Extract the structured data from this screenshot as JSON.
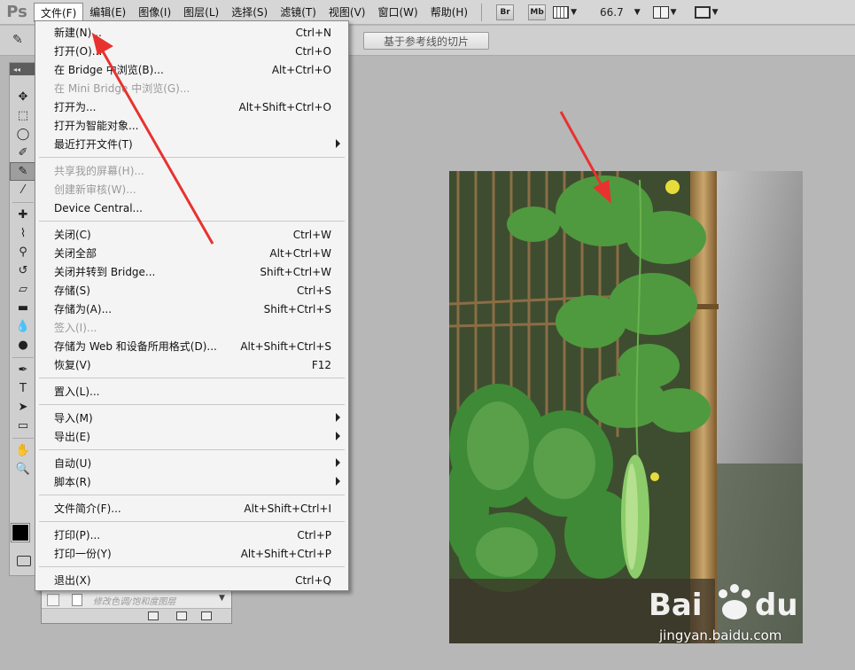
{
  "app": {
    "logo": "Ps"
  },
  "menubar": {
    "items": [
      "文件(F)",
      "编辑(E)",
      "图像(I)",
      "图层(L)",
      "选择(S)",
      "滤镜(T)",
      "视图(V)",
      "窗口(W)",
      "帮助(H)"
    ],
    "br_label": "Br",
    "mb_label": "Mb",
    "zoom": "66.7"
  },
  "options": {
    "slice_guides_label": "基于参考线的切片"
  },
  "file_menu": {
    "items": [
      {
        "label": "新建(N)...",
        "shortcut": "Ctrl+N"
      },
      {
        "label": "打开(O)...",
        "shortcut": "Ctrl+O"
      },
      {
        "label": "在 Bridge 中浏览(B)...",
        "shortcut": "Alt+Ctrl+O"
      },
      {
        "label": "在 Mini Bridge 中浏览(G)...",
        "shortcut": "",
        "disabled": true
      },
      {
        "label": "打开为...",
        "shortcut": "Alt+Shift+Ctrl+O"
      },
      {
        "label": "打开为智能对象...",
        "shortcut": ""
      },
      {
        "label": "最近打开文件(T)",
        "shortcut": "",
        "submenu": true
      },
      {
        "sep": true
      },
      {
        "label": "共享我的屏幕(H)...",
        "shortcut": "",
        "disabled": true
      },
      {
        "label": "创建新审核(W)...",
        "shortcut": "",
        "disabled": true
      },
      {
        "label": "Device Central...",
        "shortcut": ""
      },
      {
        "sep": true
      },
      {
        "label": "关闭(C)",
        "shortcut": "Ctrl+W"
      },
      {
        "label": "关闭全部",
        "shortcut": "Alt+Ctrl+W"
      },
      {
        "label": "关闭并转到 Bridge...",
        "shortcut": "Shift+Ctrl+W"
      },
      {
        "label": "存储(S)",
        "shortcut": "Ctrl+S"
      },
      {
        "label": "存储为(A)...",
        "shortcut": "Shift+Ctrl+S"
      },
      {
        "label": "签入(I)...",
        "shortcut": "",
        "disabled": true
      },
      {
        "label": "存储为 Web 和设备所用格式(D)...",
        "shortcut": "Alt+Shift+Ctrl+S"
      },
      {
        "label": "恢复(V)",
        "shortcut": "F12"
      },
      {
        "sep": true
      },
      {
        "label": "置入(L)...",
        "shortcut": ""
      },
      {
        "sep": true
      },
      {
        "label": "导入(M)",
        "shortcut": "",
        "submenu": true
      },
      {
        "label": "导出(E)",
        "shortcut": "",
        "submenu": true
      },
      {
        "sep": true
      },
      {
        "label": "自动(U)",
        "shortcut": "",
        "submenu": true
      },
      {
        "label": "脚本(R)",
        "shortcut": "",
        "submenu": true
      },
      {
        "sep": true
      },
      {
        "label": "文件简介(F)...",
        "shortcut": "Alt+Shift+Ctrl+I"
      },
      {
        "sep": true
      },
      {
        "label": "打印(P)...",
        "shortcut": "Ctrl+P"
      },
      {
        "label": "打印一份(Y)",
        "shortcut": "Alt+Shift+Ctrl+P"
      },
      {
        "sep": true
      },
      {
        "label": "退出(X)",
        "shortcut": "Ctrl+Q"
      }
    ]
  },
  "layers_panel": {
    "layer_hint": "修改色调/饱和度图层"
  },
  "watermark": {
    "url": "jingyan.baidu.com"
  },
  "colors": {
    "arrow": "#e8322f",
    "foreground": "#000000",
    "background": "#ffffff"
  }
}
